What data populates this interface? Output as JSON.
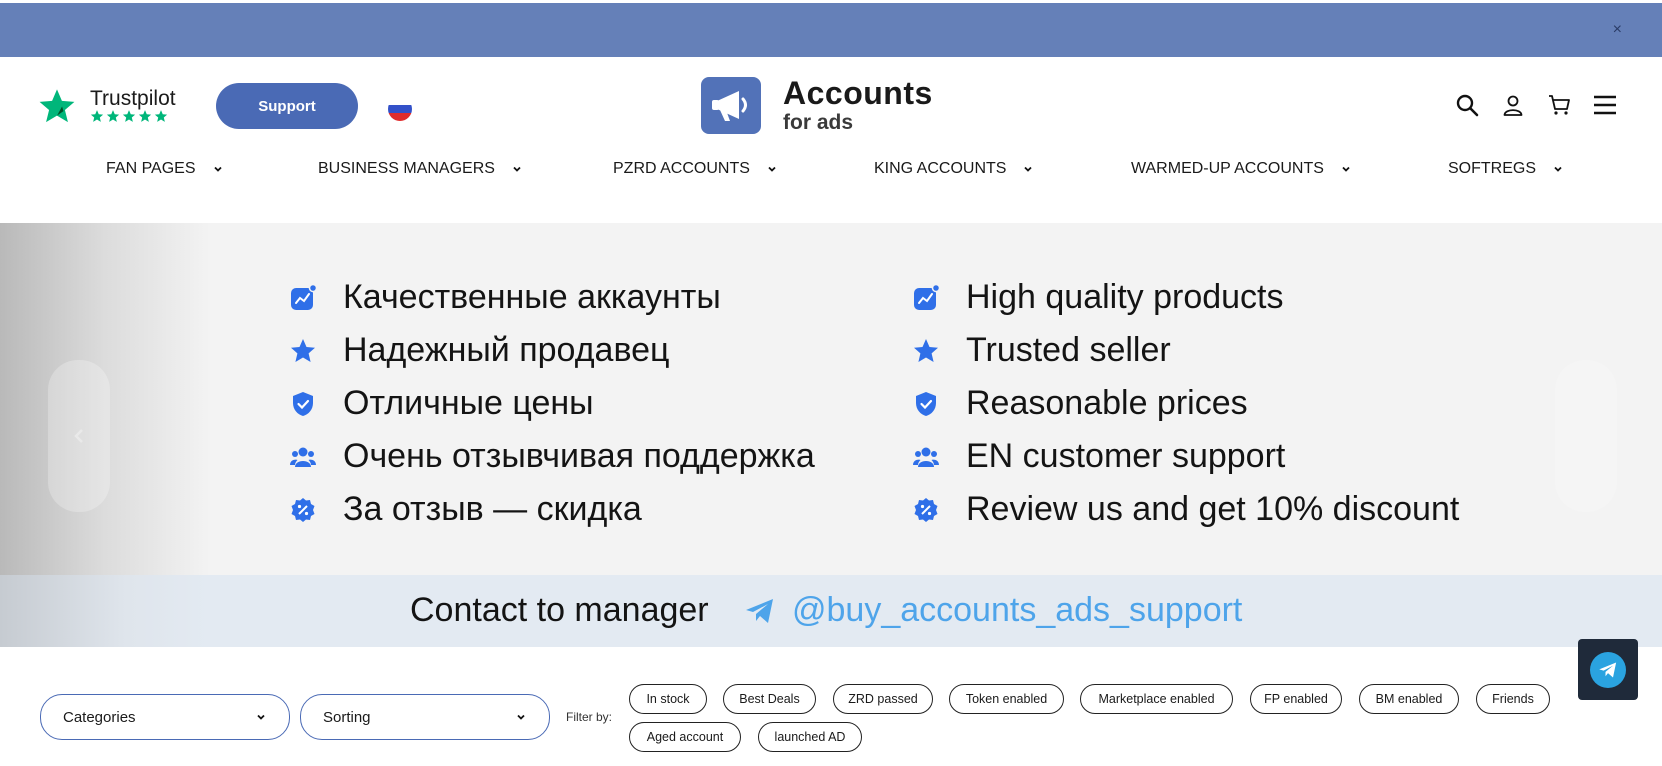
{
  "topbar": {
    "close_label": "×"
  },
  "header": {
    "trustpilot_label": "Trustpilot",
    "support_label": "Support",
    "logo_title": "Accounts",
    "logo_subtitle": "for ads",
    "icons": [
      "search-icon",
      "user-icon",
      "cart-icon",
      "menu-icon"
    ]
  },
  "nav": {
    "items": [
      {
        "label": "FAN PAGES"
      },
      {
        "label": "BUSINESS MANAGERS"
      },
      {
        "label": "PZRD ACCOUNTS"
      },
      {
        "label": "KING ACCOUNTS"
      },
      {
        "label": "WARMED-UP ACCOUNTS"
      },
      {
        "label": "SOFTREGS"
      }
    ]
  },
  "banner": {
    "ru_features": [
      "Качественные аккаунты",
      "Надежный продавец",
      "Отличные цены",
      "Очень отзывчивая поддержка",
      "За отзыв — скидка"
    ],
    "en_features": [
      "High quality products",
      "Trusted seller",
      "Reasonable prices",
      "EN customer support",
      "Review us and get 10% discount"
    ]
  },
  "contact": {
    "title": "Contact to manager",
    "handle": "@buy_accounts_ads_support"
  },
  "filters": {
    "categories_label": "Categories",
    "sorting_label": "Sorting",
    "filter_by_label": "Filter by:",
    "chips": [
      "In stock",
      "Best Deals",
      "ZRD passed",
      "Token enabled",
      "Marketplace enabled",
      "FP enabled",
      "BM enabled",
      "Friends",
      "Aged account",
      "launched AD"
    ]
  },
  "colors": {
    "topbar": "#6580b8",
    "accent": "#4a6ab5",
    "feature_icon": "#2f6fe8",
    "telegram": "#4ea4ea",
    "trustpilot_green": "#00b67a"
  }
}
